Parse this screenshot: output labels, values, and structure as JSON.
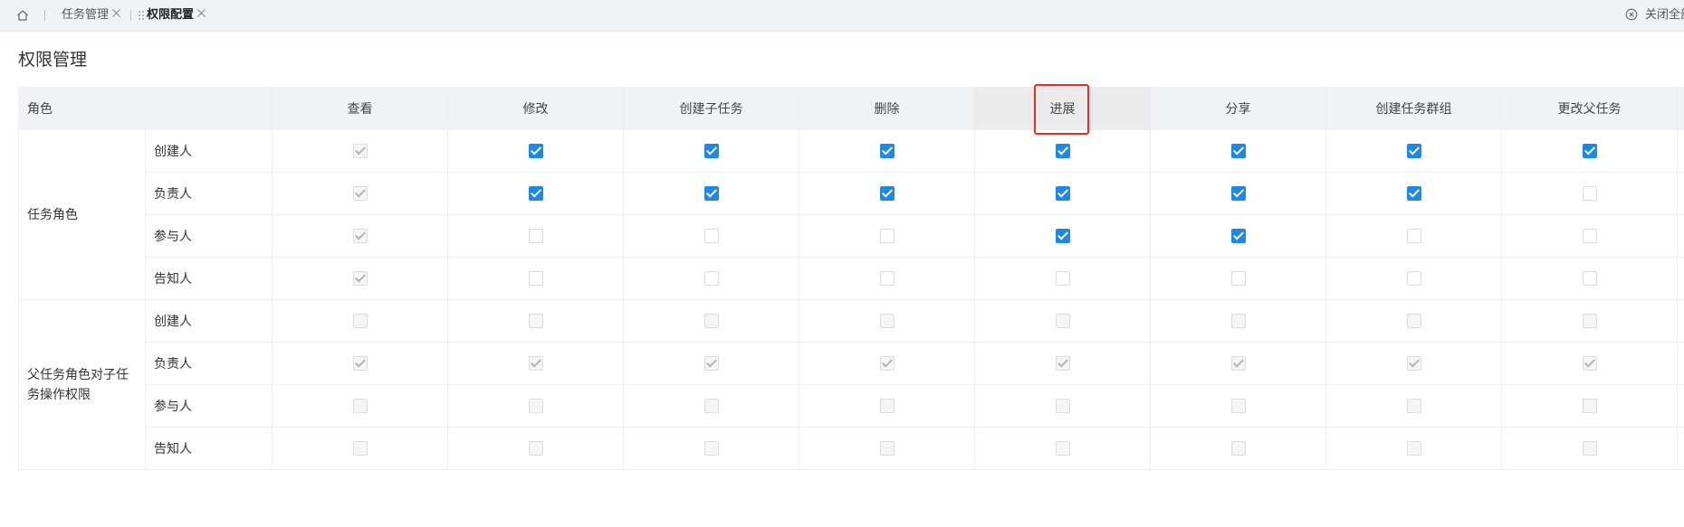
{
  "tabs": {
    "home_icon": "home-icon",
    "items": [
      {
        "label": "任务管理",
        "active": false
      },
      {
        "label": "权限配置",
        "active": true
      }
    ],
    "close_all_label": "关闭全部",
    "close_all_icon": "circle-close-icon"
  },
  "page": {
    "title": "权限管理"
  },
  "table": {
    "role_header": "角色",
    "columns": [
      "查看",
      "修改",
      "创建子任务",
      "删除",
      "进展",
      "分享",
      "创建任务群组",
      "更改父任务"
    ],
    "highlighted_column": "进展",
    "legend": {
      "checked": "checked",
      "unchecked": "unchecked",
      "disabled_checked": "disabled-checked",
      "disabled_unchecked": "disabled-unchecked"
    },
    "groups": [
      {
        "name": "任务角色",
        "rows": [
          {
            "role": "创建人",
            "cells": [
              "disabled-checked",
              "checked",
              "checked",
              "checked",
              "checked",
              "checked",
              "checked",
              "checked"
            ]
          },
          {
            "role": "负责人",
            "cells": [
              "disabled-checked",
              "checked",
              "checked",
              "checked",
              "checked",
              "checked",
              "checked",
              "unchecked"
            ]
          },
          {
            "role": "参与人",
            "cells": [
              "disabled-checked",
              "unchecked",
              "unchecked",
              "unchecked",
              "checked",
              "checked",
              "unchecked",
              "unchecked"
            ]
          },
          {
            "role": "告知人",
            "cells": [
              "disabled-checked",
              "unchecked",
              "unchecked",
              "unchecked",
              "unchecked",
              "unchecked",
              "unchecked",
              "unchecked"
            ]
          }
        ]
      },
      {
        "name": "父任务角色对子任务操作权限",
        "rows": [
          {
            "role": "创建人",
            "cells": [
              "disabled-unchecked",
              "disabled-unchecked",
              "disabled-unchecked",
              "disabled-unchecked",
              "disabled-unchecked",
              "disabled-unchecked",
              "disabled-unchecked",
              "disabled-unchecked"
            ]
          },
          {
            "role": "负责人",
            "cells": [
              "disabled-checked",
              "disabled-checked",
              "disabled-checked",
              "disabled-checked",
              "disabled-checked",
              "disabled-checked",
              "disabled-checked",
              "disabled-checked"
            ]
          },
          {
            "role": "参与人",
            "cells": [
              "disabled-unchecked",
              "disabled-unchecked",
              "disabled-unchecked",
              "disabled-unchecked",
              "disabled-unchecked",
              "disabled-unchecked",
              "disabled-unchecked",
              "disabled-unchecked"
            ]
          },
          {
            "role": "告知人",
            "cells": [
              "disabled-unchecked",
              "disabled-unchecked",
              "disabled-unchecked",
              "disabled-unchecked",
              "disabled-unchecked",
              "disabled-unchecked",
              "disabled-unchecked",
              "disabled-unchecked"
            ]
          }
        ]
      }
    ]
  },
  "colors": {
    "accent": "#1e88e5",
    "highlight": "#e52d2d",
    "header_bg": "#f0f2f6"
  }
}
